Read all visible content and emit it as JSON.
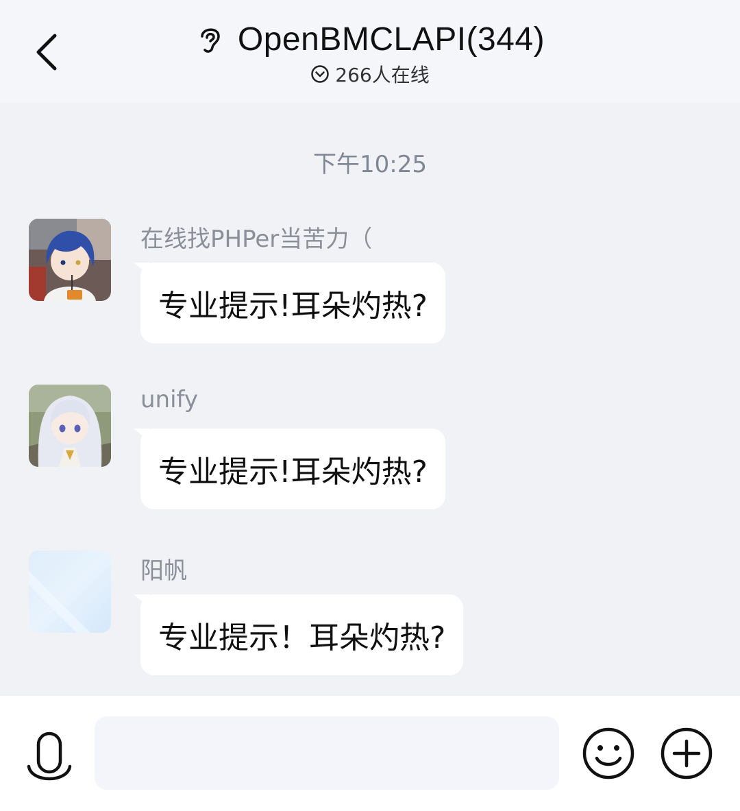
{
  "header": {
    "back_icon": "chevron-left-icon",
    "mode_icon": "ear-icon",
    "title": "OpenBMCLAPI(344)",
    "online_icon": "chevron-down-circle-icon",
    "online_count": "266人在线"
  },
  "timestamp": "下午10:25",
  "messages": [
    {
      "sender": "在线找PHPer当苦力（",
      "text": "专业提示!耳朵灼热?",
      "avatar": "anime-avatar-blue-hair"
    },
    {
      "sender": "unify",
      "text": "专业提示!耳朵灼热?",
      "avatar": "anime-avatar-silver-hair"
    },
    {
      "sender": "阳帆",
      "text": "专业提示！耳朵灼热?",
      "avatar": "light-blue-avatar"
    }
  ],
  "input_bar": {
    "voice_icon": "microphone-icon",
    "placeholder": "",
    "emoji_icon": "smiley-icon",
    "more_icon": "plus-circle-icon"
  },
  "colors": {
    "background": "#f1f2f5",
    "header_bg": "#f5f6fa",
    "bubble": "#ffffff",
    "sender_text": "#8b8f99",
    "timestamp_text": "#7f8694"
  }
}
